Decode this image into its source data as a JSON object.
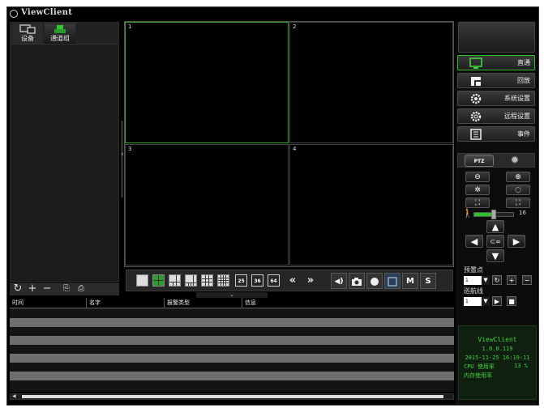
{
  "window": {
    "title": "ViewClient"
  },
  "left_panel": {
    "tabs": [
      {
        "label": "设备",
        "icon": "device-icon"
      },
      {
        "label": "通道组",
        "icon": "channel-group-icon"
      }
    ],
    "toolbar": [
      "refresh-icon",
      "add-icon",
      "remove-icon",
      "import-icon",
      "export-icon"
    ]
  },
  "video_grid": {
    "cells": [
      {
        "number": "1",
        "selected": true
      },
      {
        "number": "2",
        "selected": false
      },
      {
        "number": "3",
        "selected": false
      },
      {
        "number": "4",
        "selected": false
      }
    ]
  },
  "layout_bar": {
    "split_buttons": [
      "layout-1",
      "layout-4",
      "layout-6",
      "layout-8",
      "layout-9",
      "layout-16"
    ],
    "active_layout": "layout-4",
    "number_buttons": [
      "25",
      "36",
      "64"
    ],
    "prev_label": "«",
    "next_label": "»",
    "tools": [
      {
        "name": "audio-icon",
        "label": "◀)"
      },
      {
        "name": "snapshot-icon",
        "label": ""
      },
      {
        "name": "record-icon",
        "label": ""
      },
      {
        "name": "fullscreen-icon",
        "label": ""
      },
      {
        "name": "main-stream-button",
        "label": "M"
      },
      {
        "name": "sub-stream-button",
        "label": "S"
      }
    ],
    "split_handle": "⌄"
  },
  "nav": [
    {
      "label": "直通",
      "icon": "monitor-icon",
      "active": true
    },
    {
      "label": "回放",
      "icon": "playback-icon",
      "active": false
    },
    {
      "label": "系统设置",
      "icon": "gear-icon",
      "active": false
    },
    {
      "label": "远程设置",
      "icon": "remote-gear-icon",
      "active": false
    },
    {
      "label": "事件",
      "icon": "event-list-icon",
      "active": false
    }
  ],
  "ptz": {
    "tab_label": "PTZ",
    "speed_value": "16",
    "speed_fraction": 0.5,
    "center_label": "⊂∞",
    "preset_label": "预置点",
    "preset_value": "1",
    "cruise_label": "巡航线",
    "cruise_value": "1"
  },
  "alarm_table": {
    "columns": [
      "时间",
      "名字",
      "报警类型",
      "信息"
    ]
  },
  "info": {
    "app": "ViewClient",
    "version": "1.0.0.119",
    "datetime": "2015-11-25 16:19:11",
    "cpu_label": "CPU 使用率",
    "cpu_value": "13 %",
    "mem_label": "内存使用率"
  },
  "colors": {
    "accent": "#29a329",
    "background": "#000000",
    "info_text": "#3fd13f"
  }
}
